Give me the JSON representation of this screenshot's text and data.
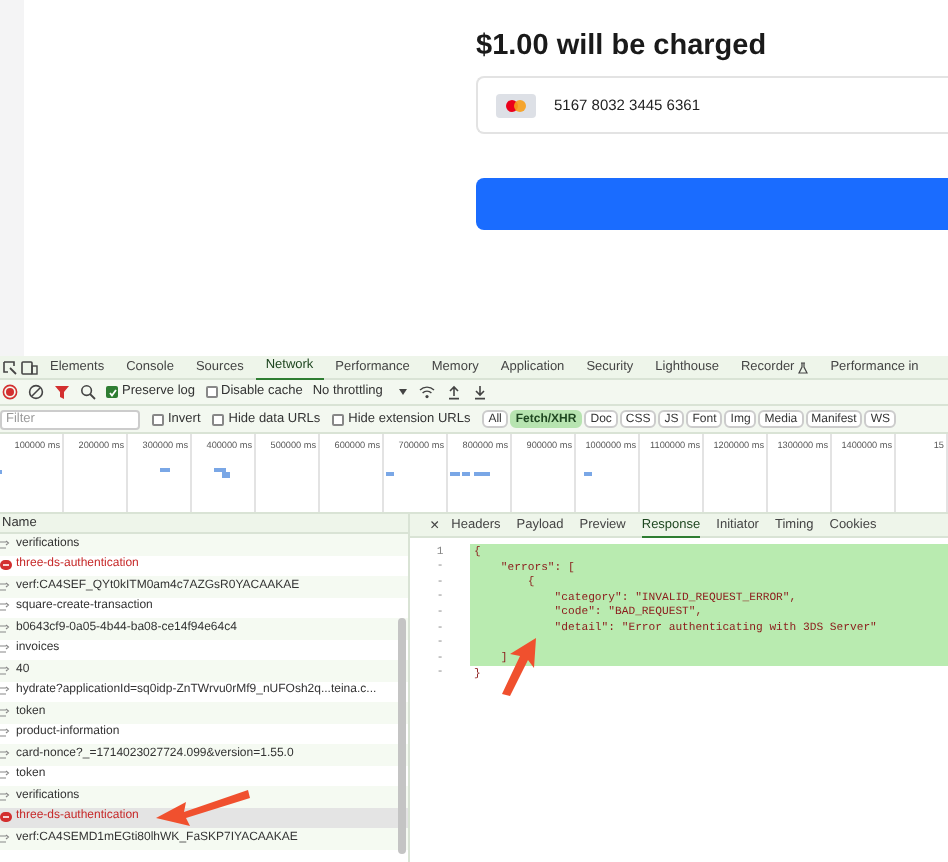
{
  "checkout": {
    "heading": "$1.00 will be charged",
    "card_number": "5167 8032 3445 6361"
  },
  "devtools": {
    "tabs": [
      {
        "label": "Elements",
        "selected": false
      },
      {
        "label": "Console",
        "selected": false
      },
      {
        "label": "Sources",
        "selected": false
      },
      {
        "label": "Network",
        "selected": true
      },
      {
        "label": "Performance",
        "selected": false
      },
      {
        "label": "Memory",
        "selected": false
      },
      {
        "label": "Application",
        "selected": false
      },
      {
        "label": "Security",
        "selected": false
      },
      {
        "label": "Lighthouse",
        "selected": false
      },
      {
        "label": "Recorder",
        "selected": false,
        "kind": "flask"
      },
      {
        "label": "Performance in",
        "selected": false
      }
    ],
    "toolbar": {
      "preserve_log": {
        "label": "Preserve log",
        "checked": true
      },
      "disable_cache": {
        "label": "Disable cache",
        "checked": false
      },
      "throttling": "No throttling"
    },
    "filter": {
      "placeholder": "Filter",
      "options": [
        {
          "label": "Invert",
          "checked": false
        },
        {
          "label": "Hide data URLs",
          "checked": false
        },
        {
          "label": "Hide extension URLs",
          "checked": false
        }
      ],
      "types": [
        {
          "label": "All",
          "selected": false
        },
        {
          "label": "Fetch/XHR",
          "selected": true
        },
        {
          "label": "Doc",
          "selected": false
        },
        {
          "label": "CSS",
          "selected": false
        },
        {
          "label": "JS",
          "selected": false
        },
        {
          "label": "Font",
          "selected": false
        },
        {
          "label": "Img",
          "selected": false
        },
        {
          "label": "Media",
          "selected": false
        },
        {
          "label": "Manifest",
          "selected": false
        },
        {
          "label": "WS",
          "selected": false
        }
      ]
    },
    "timeline_ticks": [
      "100000 ms",
      "200000 ms",
      "300000 ms",
      "400000 ms",
      "500000 ms",
      "600000 ms",
      "700000 ms",
      "800000 ms",
      "900000 ms",
      "1000000 ms",
      "1100000 ms",
      "1200000 ms",
      "1300000 ms",
      "1400000 ms",
      "15"
    ],
    "requests": {
      "column": "Name",
      "rows": [
        {
          "name": "verifications",
          "error": false,
          "selected": false
        },
        {
          "name": "three-ds-authentication",
          "error": true,
          "selected": false
        },
        {
          "name": "verf:CA4SEF_QYt0kITM0am4c7AZGsR0YACAAKAE",
          "error": false,
          "selected": false
        },
        {
          "name": "square-create-transaction",
          "error": false,
          "selected": false
        },
        {
          "name": "b0643cf9-0a05-4b44-ba08-ce14f94e64c4",
          "error": false,
          "selected": false
        },
        {
          "name": "invoices",
          "error": false,
          "selected": false
        },
        {
          "name": "40",
          "error": false,
          "selected": false
        },
        {
          "name": "hydrate?applicationId=sq0idp-ZnTWrvu0rMf9_nUFOsh2q...teina.c...",
          "error": false,
          "selected": false
        },
        {
          "name": "token",
          "error": false,
          "selected": false
        },
        {
          "name": "product-information",
          "error": false,
          "selected": false
        },
        {
          "name": "card-nonce?_=1714023027724.099&version=1.55.0",
          "error": false,
          "selected": false
        },
        {
          "name": "token",
          "error": false,
          "selected": false
        },
        {
          "name": "verifications",
          "error": false,
          "selected": false
        },
        {
          "name": "three-ds-authentication",
          "error": true,
          "selected": true
        },
        {
          "name": "verf:CA4SEMD1mEGti80lhWK_FaSKP7IYACAAKAE",
          "error": false,
          "selected": false
        }
      ]
    },
    "details": {
      "close": "×",
      "tabs": [
        {
          "label": "Headers",
          "selected": false
        },
        {
          "label": "Payload",
          "selected": false
        },
        {
          "label": "Preview",
          "selected": false
        },
        {
          "label": "Response",
          "selected": true
        },
        {
          "label": "Initiator",
          "selected": false
        },
        {
          "label": "Timing",
          "selected": false
        },
        {
          "label": "Cookies",
          "selected": false
        }
      ],
      "response_lines": [
        {
          "gutter": "1",
          "text": "{",
          "highlighted": true
        },
        {
          "gutter": "-",
          "text": "    \"errors\": [",
          "highlighted": true
        },
        {
          "gutter": "-",
          "text": "        {",
          "highlighted": true
        },
        {
          "gutter": "-",
          "text": "            \"category\": \"INVALID_REQUEST_ERROR\",",
          "highlighted": true
        },
        {
          "gutter": "-",
          "text": "            \"code\": \"BAD_REQUEST\",",
          "highlighted": true
        },
        {
          "gutter": "-",
          "text": "            \"detail\": \"Error authenticating with 3DS Server\"",
          "highlighted": true
        },
        {
          "gutter": "-",
          "highlighted": true
        },
        {
          "gutter": "-",
          "text": "    ]",
          "highlighted": true
        },
        {
          "gutter": "-",
          "text": "}",
          "highlighted": false
        }
      ]
    }
  }
}
